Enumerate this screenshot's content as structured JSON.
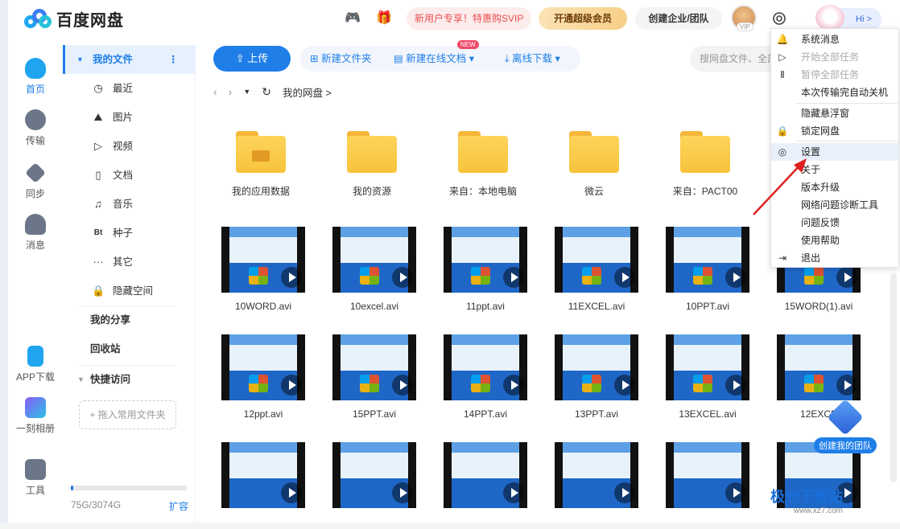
{
  "header": {
    "app_name": "百度网盘",
    "promo": "新用户专享！特惠购SVIP",
    "svip": "开通超级会员",
    "team": "创建企业/团队",
    "vip_tag": "VIP",
    "hi": "Hi >"
  },
  "leftnav": [
    {
      "label": "首页"
    },
    {
      "label": "传输"
    },
    {
      "label": "同步"
    },
    {
      "label": "消息"
    },
    {
      "label": "APP下载"
    },
    {
      "label": "一刻相册"
    },
    {
      "label": "工具"
    }
  ],
  "sidebar": {
    "my_files": "我的文件",
    "items": [
      "最近",
      "图片",
      "视频",
      "文档",
      "音乐",
      "种子",
      "其它",
      "隐藏空间"
    ],
    "bt_label": "Bt",
    "my_share": "我的分享",
    "recycle": "回收站",
    "quick_access": "快捷访问",
    "drag_hint": "+ 拖入常用文件夹",
    "storage": "75G/3074G",
    "expand": "扩容",
    "storage_used_fraction": 0.024
  },
  "toolbar": {
    "upload": "上传",
    "new_folder": "新建文件夹",
    "new_doc": "新建在线文档",
    "new_badge": "NEW",
    "offline": "离线下载",
    "search_placeholder": "搜网盘文件、全部"
  },
  "breadcrumb": {
    "current": "我的网盘",
    "sep": ">"
  },
  "folders": [
    "我的应用数据",
    "我的资源",
    "来自：本地电脑",
    "微云",
    "来自：PACT00"
  ],
  "videos_row1": [
    "10WORD.avi",
    "10excel.avi",
    "11ppt.avi",
    "11EXCEL.avi",
    "10PPT.avi",
    "15WORD(1).avi"
  ],
  "videos_row2": [
    "12ppt.avi",
    "15PPT.avi",
    "14PPT.avi",
    "13PPT.avi",
    "13EXCEL.avi",
    "12EXCE"
  ],
  "menu": {
    "items": [
      "系统消息",
      "开始全部任务",
      "暂停全部任务",
      "本次传输完自动关机",
      "隐藏悬浮窗",
      "锁定网盘",
      "设置",
      "关于",
      "版本升级",
      "网络问题诊断工具",
      "问题反馈",
      "使用帮助",
      "退出"
    ],
    "disabled": [
      "开始全部任务",
      "暂停全部任务"
    ],
    "hovered": "设置"
  },
  "float_team": "创建我的团队",
  "watermark": {
    "title": "极光下载站",
    "url": "www.xz7.com"
  },
  "colors": {
    "accent": "#1f7ee8",
    "promo": "#e94f4f",
    "folder": "#f7c33b"
  }
}
